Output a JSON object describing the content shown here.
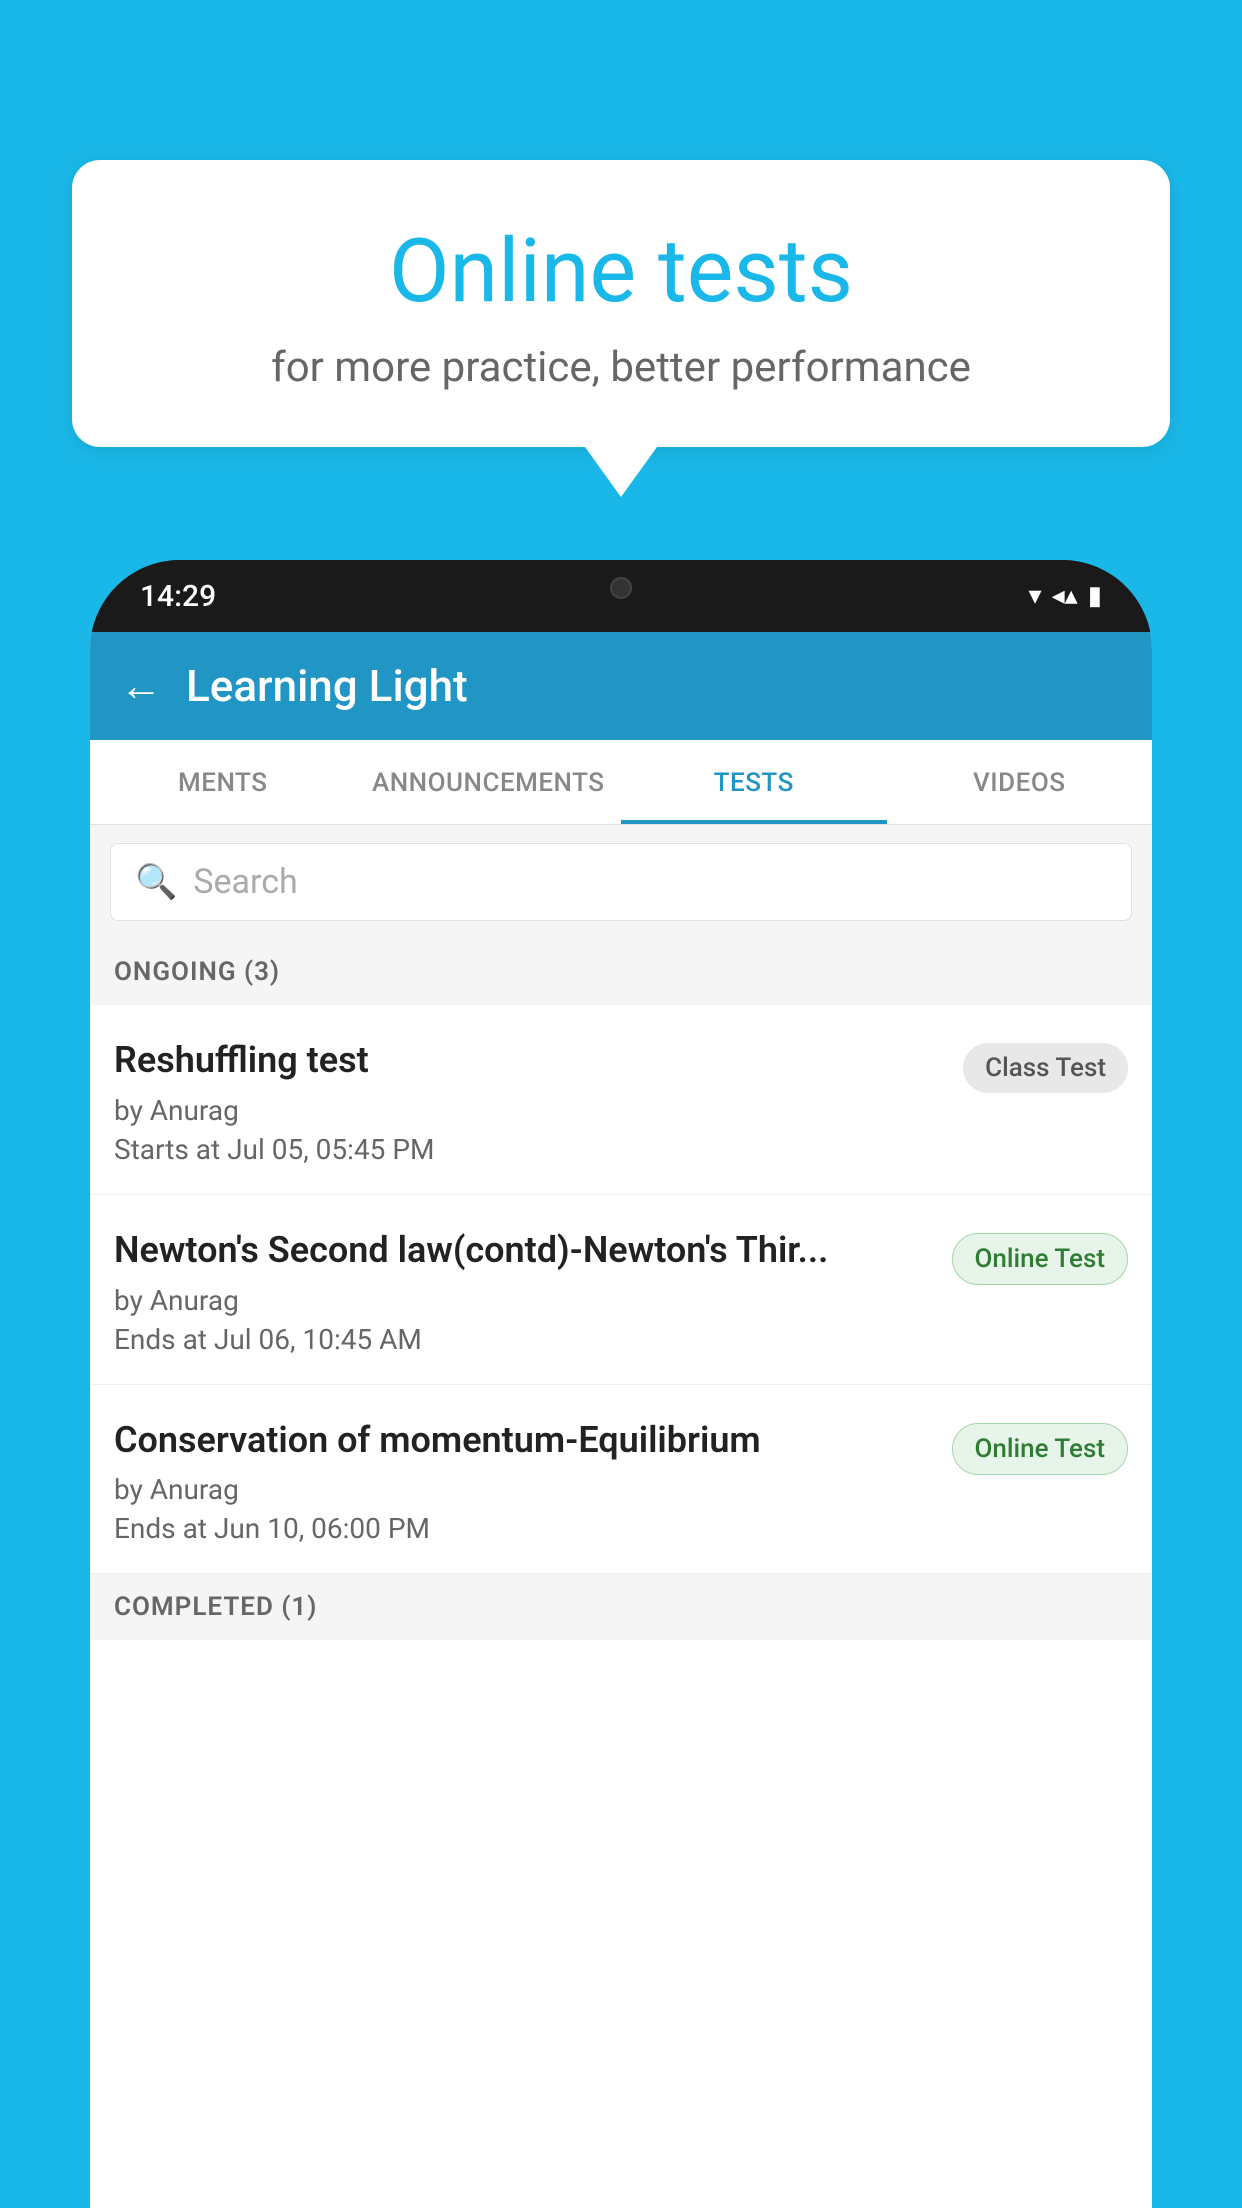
{
  "background_color": "#1ab8e8",
  "speech_bubble": {
    "title": "Online tests",
    "subtitle": "for more practice, better performance"
  },
  "phone": {
    "status_bar": {
      "time": "14:29",
      "wifi": "▾",
      "signal": "▲",
      "battery": "▮"
    },
    "header": {
      "back_label": "←",
      "title": "Learning Light"
    },
    "tabs": [
      {
        "label": "MENTS",
        "active": false
      },
      {
        "label": "ANNOUNCEMENTS",
        "active": false
      },
      {
        "label": "TESTS",
        "active": true
      },
      {
        "label": "VIDEOS",
        "active": false
      }
    ],
    "search": {
      "placeholder": "Search"
    },
    "ongoing_section": {
      "label": "ONGOING (3)"
    },
    "test_items": [
      {
        "title": "Reshuffling test",
        "author": "by Anurag",
        "time_label": "Starts at",
        "time": "Jul 05, 05:45 PM",
        "badge": "Class Test",
        "badge_type": "class"
      },
      {
        "title": "Newton's Second law(contd)-Newton's Thir...",
        "author": "by Anurag",
        "time_label": "Ends at",
        "time": "Jul 06, 10:45 AM",
        "badge": "Online Test",
        "badge_type": "online"
      },
      {
        "title": "Conservation of momentum-Equilibrium",
        "author": "by Anurag",
        "time_label": "Ends at",
        "time": "Jun 10, 06:00 PM",
        "badge": "Online Test",
        "badge_type": "online"
      }
    ],
    "completed_section": {
      "label": "COMPLETED (1)"
    }
  }
}
